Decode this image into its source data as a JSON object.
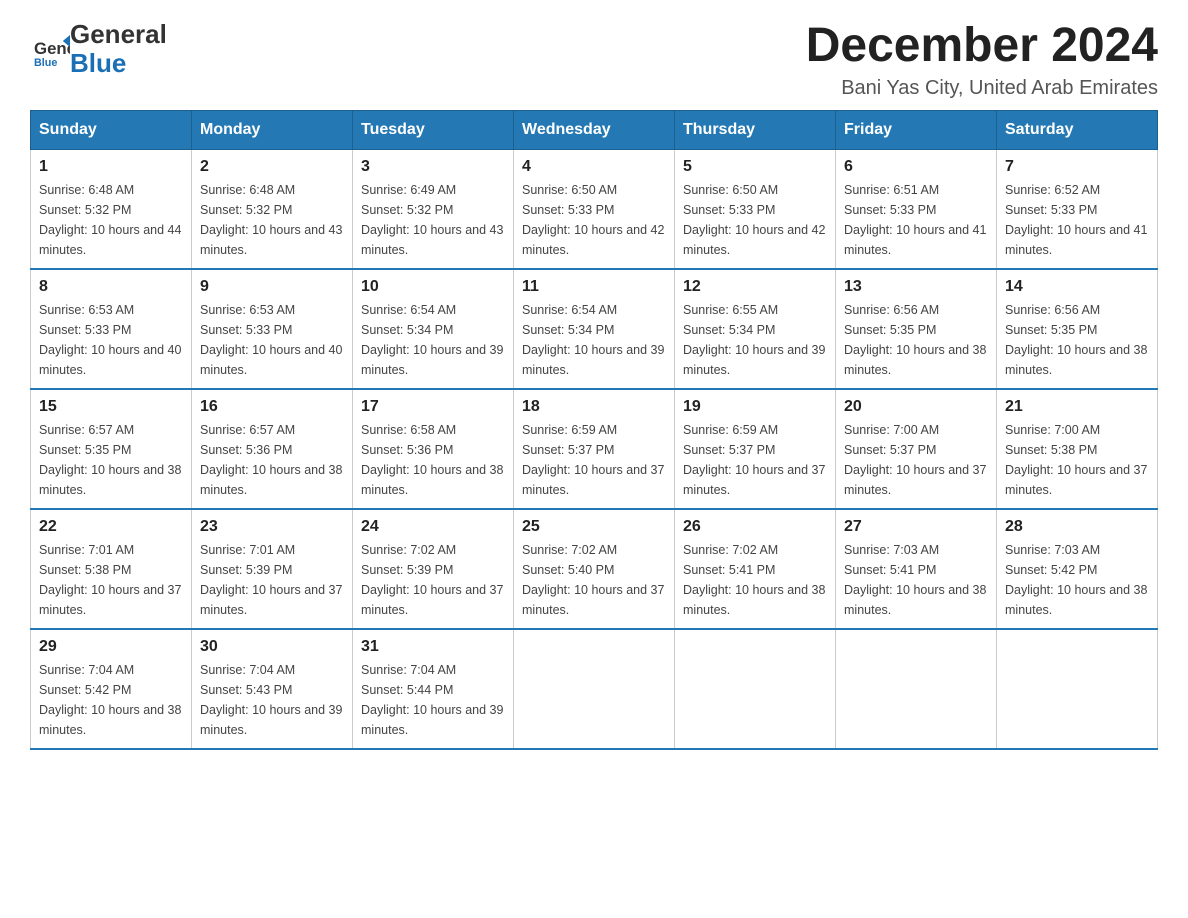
{
  "logo": {
    "general": "General",
    "blue": "Blue"
  },
  "header": {
    "month_title": "December 2024",
    "subtitle": "Bani Yas City, United Arab Emirates"
  },
  "days_of_week": [
    "Sunday",
    "Monday",
    "Tuesday",
    "Wednesday",
    "Thursday",
    "Friday",
    "Saturday"
  ],
  "weeks": [
    [
      {
        "day": "1",
        "sunrise": "6:48 AM",
        "sunset": "5:32 PM",
        "daylight": "10 hours and 44 minutes."
      },
      {
        "day": "2",
        "sunrise": "6:48 AM",
        "sunset": "5:32 PM",
        "daylight": "10 hours and 43 minutes."
      },
      {
        "day": "3",
        "sunrise": "6:49 AM",
        "sunset": "5:32 PM",
        "daylight": "10 hours and 43 minutes."
      },
      {
        "day": "4",
        "sunrise": "6:50 AM",
        "sunset": "5:33 PM",
        "daylight": "10 hours and 42 minutes."
      },
      {
        "day": "5",
        "sunrise": "6:50 AM",
        "sunset": "5:33 PM",
        "daylight": "10 hours and 42 minutes."
      },
      {
        "day": "6",
        "sunrise": "6:51 AM",
        "sunset": "5:33 PM",
        "daylight": "10 hours and 41 minutes."
      },
      {
        "day": "7",
        "sunrise": "6:52 AM",
        "sunset": "5:33 PM",
        "daylight": "10 hours and 41 minutes."
      }
    ],
    [
      {
        "day": "8",
        "sunrise": "6:53 AM",
        "sunset": "5:33 PM",
        "daylight": "10 hours and 40 minutes."
      },
      {
        "day": "9",
        "sunrise": "6:53 AM",
        "sunset": "5:33 PM",
        "daylight": "10 hours and 40 minutes."
      },
      {
        "day": "10",
        "sunrise": "6:54 AM",
        "sunset": "5:34 PM",
        "daylight": "10 hours and 39 minutes."
      },
      {
        "day": "11",
        "sunrise": "6:54 AM",
        "sunset": "5:34 PM",
        "daylight": "10 hours and 39 minutes."
      },
      {
        "day": "12",
        "sunrise": "6:55 AM",
        "sunset": "5:34 PM",
        "daylight": "10 hours and 39 minutes."
      },
      {
        "day": "13",
        "sunrise": "6:56 AM",
        "sunset": "5:35 PM",
        "daylight": "10 hours and 38 minutes."
      },
      {
        "day": "14",
        "sunrise": "6:56 AM",
        "sunset": "5:35 PM",
        "daylight": "10 hours and 38 minutes."
      }
    ],
    [
      {
        "day": "15",
        "sunrise": "6:57 AM",
        "sunset": "5:35 PM",
        "daylight": "10 hours and 38 minutes."
      },
      {
        "day": "16",
        "sunrise": "6:57 AM",
        "sunset": "5:36 PM",
        "daylight": "10 hours and 38 minutes."
      },
      {
        "day": "17",
        "sunrise": "6:58 AM",
        "sunset": "5:36 PM",
        "daylight": "10 hours and 38 minutes."
      },
      {
        "day": "18",
        "sunrise": "6:59 AM",
        "sunset": "5:37 PM",
        "daylight": "10 hours and 37 minutes."
      },
      {
        "day": "19",
        "sunrise": "6:59 AM",
        "sunset": "5:37 PM",
        "daylight": "10 hours and 37 minutes."
      },
      {
        "day": "20",
        "sunrise": "7:00 AM",
        "sunset": "5:37 PM",
        "daylight": "10 hours and 37 minutes."
      },
      {
        "day": "21",
        "sunrise": "7:00 AM",
        "sunset": "5:38 PM",
        "daylight": "10 hours and 37 minutes."
      }
    ],
    [
      {
        "day": "22",
        "sunrise": "7:01 AM",
        "sunset": "5:38 PM",
        "daylight": "10 hours and 37 minutes."
      },
      {
        "day": "23",
        "sunrise": "7:01 AM",
        "sunset": "5:39 PM",
        "daylight": "10 hours and 37 minutes."
      },
      {
        "day": "24",
        "sunrise": "7:02 AM",
        "sunset": "5:39 PM",
        "daylight": "10 hours and 37 minutes."
      },
      {
        "day": "25",
        "sunrise": "7:02 AM",
        "sunset": "5:40 PM",
        "daylight": "10 hours and 37 minutes."
      },
      {
        "day": "26",
        "sunrise": "7:02 AM",
        "sunset": "5:41 PM",
        "daylight": "10 hours and 38 minutes."
      },
      {
        "day": "27",
        "sunrise": "7:03 AM",
        "sunset": "5:41 PM",
        "daylight": "10 hours and 38 minutes."
      },
      {
        "day": "28",
        "sunrise": "7:03 AM",
        "sunset": "5:42 PM",
        "daylight": "10 hours and 38 minutes."
      }
    ],
    [
      {
        "day": "29",
        "sunrise": "7:04 AM",
        "sunset": "5:42 PM",
        "daylight": "10 hours and 38 minutes."
      },
      {
        "day": "30",
        "sunrise": "7:04 AM",
        "sunset": "5:43 PM",
        "daylight": "10 hours and 39 minutes."
      },
      {
        "day": "31",
        "sunrise": "7:04 AM",
        "sunset": "5:44 PM",
        "daylight": "10 hours and 39 minutes."
      },
      null,
      null,
      null,
      null
    ]
  ]
}
